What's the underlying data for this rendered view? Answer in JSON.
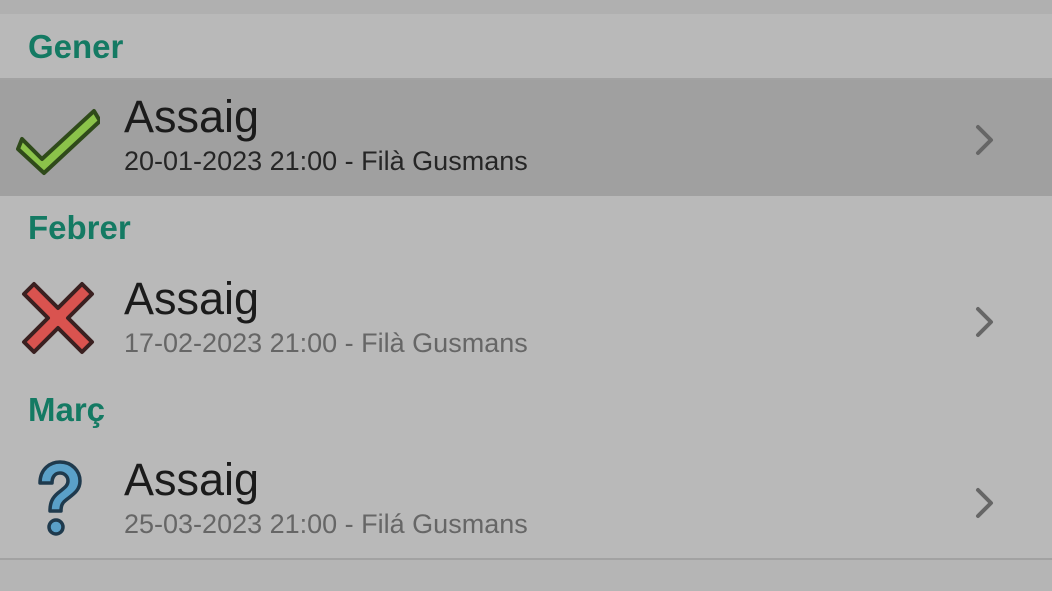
{
  "sections": [
    {
      "header": "Gener",
      "items": [
        {
          "status_icon": "check-icon",
          "title": "Assaig",
          "subtitle": "20-01-2023 21:00 - Filà Gusmans",
          "selected": true
        }
      ]
    },
    {
      "header": "Febrer",
      "items": [
        {
          "status_icon": "cross-icon",
          "title": "Assaig",
          "subtitle": "17-02-2023 21:00 - Filà Gusmans",
          "selected": false
        }
      ]
    },
    {
      "header": "Març",
      "items": [
        {
          "status_icon": "question-icon",
          "title": "Assaig",
          "subtitle": "25-03-2023 21:00 - Filá Gusmans",
          "selected": false
        }
      ]
    }
  ],
  "colors": {
    "header_text": "#147a63",
    "check": "#8bc34a",
    "cross": "#d9534f",
    "question": "#5aa0c8"
  }
}
